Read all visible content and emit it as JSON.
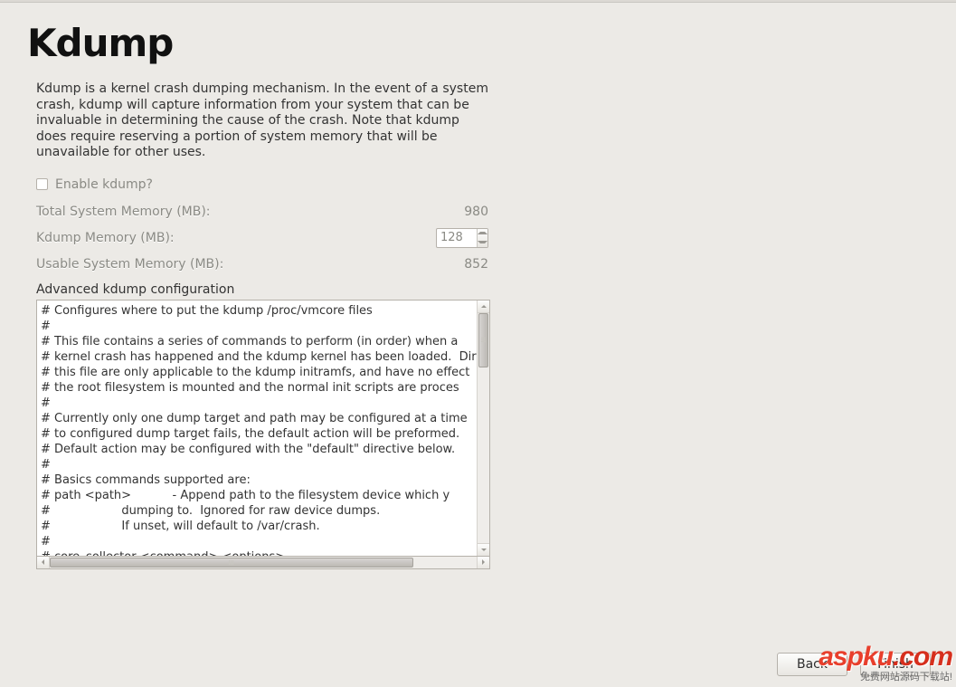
{
  "title": "Kdump",
  "description": "Kdump is a kernel crash dumping mechanism. In the event of a system crash, kdump will capture information from your system that can be invaluable in determining the cause of the crash. Note that kdump does require reserving a portion of system memory that will be unavailable for other uses.",
  "enable": {
    "label": "Enable kdump?",
    "checked": false
  },
  "memory": {
    "total_label": "Total System Memory (MB):",
    "total_value": "980",
    "kdump_label": "Kdump Memory (MB):",
    "kdump_value": "128",
    "usable_label": "Usable System Memory (MB):",
    "usable_value": "852"
  },
  "advanced": {
    "label": "Advanced kdump configuration",
    "content": "# Configures where to put the kdump /proc/vmcore files\n#\n# This file contains a series of commands to perform (in order) when a\n# kernel crash has happened and the kdump kernel has been loaded.  Dir\n# this file are only applicable to the kdump initramfs, and have no effect\n# the root filesystem is mounted and the normal init scripts are proces\n#\n# Currently only one dump target and path may be configured at a time\n# to configured dump target fails, the default action will be preformed.\n# Default action may be configured with the \"default\" directive below.\n#\n# Basics commands supported are:\n# path <path>           - Append path to the filesystem device which y\n#                   dumping to.  Ignored for raw device dumps.\n#                   If unset, will default to /var/crash.\n#\n# core_collector <command> <options>"
  },
  "buttons": {
    "back": "Back",
    "finish": "Finish"
  },
  "watermark": {
    "brand": "aspku",
    "suffix": ".com",
    "tagline": "免费网站源码下载站!"
  }
}
